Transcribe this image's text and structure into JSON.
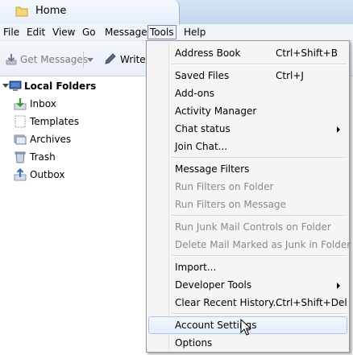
{
  "tab": {
    "title": "Home",
    "icon": "folder-icon"
  },
  "menubar": {
    "items": [
      {
        "label": "File"
      },
      {
        "label": "Edit"
      },
      {
        "label": "View"
      },
      {
        "label": "Go"
      },
      {
        "label": "Message"
      },
      {
        "label": "Tools"
      },
      {
        "label": "Help"
      }
    ],
    "active": "Tools"
  },
  "toolbar": {
    "get_messages": "Get Messages",
    "write": "Write"
  },
  "folders": {
    "root": "Local Folders",
    "items": [
      {
        "label": "Inbox",
        "icon": "inbox-icon"
      },
      {
        "label": "Templates",
        "icon": "templates-icon"
      },
      {
        "label": "Archives",
        "icon": "archives-icon"
      },
      {
        "label": "Trash",
        "icon": "trash-icon"
      },
      {
        "label": "Outbox",
        "icon": "outbox-icon"
      }
    ]
  },
  "tools_menu": {
    "items": [
      {
        "label": "Address Book",
        "shortcut": "Ctrl+Shift+B"
      },
      {
        "label": "Saved Files",
        "shortcut": "Ctrl+J"
      },
      {
        "label": "Add-ons",
        "shortcut": ""
      },
      {
        "label": "Activity Manager",
        "shortcut": ""
      },
      {
        "label": "Chat status",
        "shortcut": ""
      },
      {
        "label": "Join Chat...",
        "shortcut": ""
      },
      {
        "label": "Message Filters",
        "shortcut": ""
      },
      {
        "label": "Run Filters on Folder",
        "shortcut": ""
      },
      {
        "label": "Run Filters on Message",
        "shortcut": ""
      },
      {
        "label": "Run Junk Mail Controls on Folder",
        "shortcut": ""
      },
      {
        "label": "Delete Mail Marked as Junk in Folder",
        "shortcut": ""
      },
      {
        "label": "Import...",
        "shortcut": ""
      },
      {
        "label": "Developer Tools",
        "shortcut": ""
      },
      {
        "label": "Clear Recent History...",
        "shortcut": "Ctrl+Shift+Del"
      },
      {
        "label": "Account Settings",
        "shortcut": ""
      },
      {
        "label": "Options",
        "shortcut": ""
      }
    ],
    "highlighted": "Account Settings"
  }
}
